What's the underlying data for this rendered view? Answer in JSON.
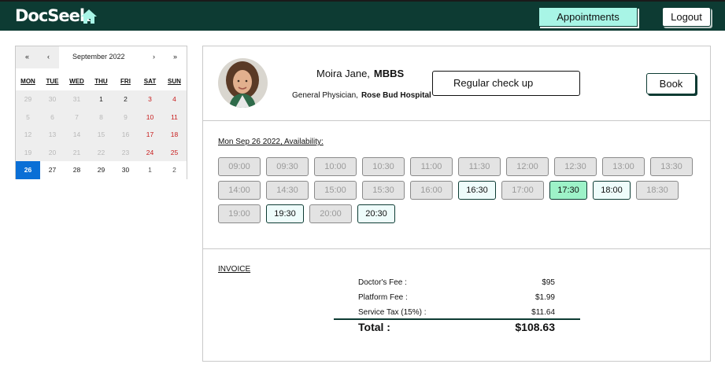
{
  "header": {
    "brand": "DocSeek",
    "appointments_label": "Appointments",
    "logout_label": "Logout",
    "colors": {
      "bar": "#0d3b33",
      "accent": "#a8f5e6"
    }
  },
  "calendar": {
    "nav": {
      "first": "«",
      "prev": "‹",
      "next": "›",
      "last": "»"
    },
    "month_label": "September 2022",
    "weekdays": [
      "MON",
      "TUE",
      "WED",
      "THU",
      "FRI",
      "SAT",
      "SUN"
    ],
    "days": [
      "29",
      "30",
      "31",
      "1",
      "2",
      "3",
      "4",
      "5",
      "6",
      "7",
      "8",
      "9",
      "10",
      "11",
      "12",
      "13",
      "14",
      "15",
      "16",
      "17",
      "18",
      "19",
      "20",
      "21",
      "22",
      "23",
      "24",
      "25",
      "26",
      "27",
      "28",
      "29",
      "30",
      "1",
      "2"
    ],
    "selected_day": "26"
  },
  "doctor": {
    "name": "Moira Jane,",
    "degree": "MBBS",
    "specialty": "General Physician,",
    "hospital": "Rose Bud Hospital",
    "reason": "Regular check up",
    "book_label": "Book"
  },
  "availability": {
    "label": "Mon Sep 26 2022, Availability:",
    "slots": [
      {
        "time": "09:00",
        "state": "unavailable"
      },
      {
        "time": "09:30",
        "state": "unavailable"
      },
      {
        "time": "10:00",
        "state": "unavailable"
      },
      {
        "time": "10:30",
        "state": "unavailable"
      },
      {
        "time": "11:00",
        "state": "unavailable"
      },
      {
        "time": "11:30",
        "state": "unavailable"
      },
      {
        "time": "12:00",
        "state": "unavailable"
      },
      {
        "time": "12:30",
        "state": "unavailable"
      },
      {
        "time": "13:00",
        "state": "unavailable"
      },
      {
        "time": "13:30",
        "state": "unavailable"
      },
      {
        "time": "14:00",
        "state": "unavailable"
      },
      {
        "time": "14:30",
        "state": "unavailable"
      },
      {
        "time": "15:00",
        "state": "unavailable"
      },
      {
        "time": "15:30",
        "state": "unavailable"
      },
      {
        "time": "16:00",
        "state": "unavailable"
      },
      {
        "time": "16:30",
        "state": "available"
      },
      {
        "time": "17:00",
        "state": "unavailable"
      },
      {
        "time": "17:30",
        "state": "selected"
      },
      {
        "time": "18:00",
        "state": "available"
      },
      {
        "time": "18:30",
        "state": "unavailable"
      },
      {
        "time": "19:00",
        "state": "unavailable"
      },
      {
        "time": "19:30",
        "state": "available"
      },
      {
        "time": "20:00",
        "state": "unavailable"
      },
      {
        "time": "20:30",
        "state": "available"
      }
    ]
  },
  "invoice": {
    "title": "INVOICE",
    "rows": [
      {
        "label": "Doctor's Fee :",
        "amount": "$95"
      },
      {
        "label": "Platform Fee :",
        "amount": "$1.99"
      },
      {
        "label": "Service Tax (15%) :",
        "amount": "$11.64"
      }
    ],
    "total_label": "Total :",
    "total_amount": "$108.63"
  }
}
